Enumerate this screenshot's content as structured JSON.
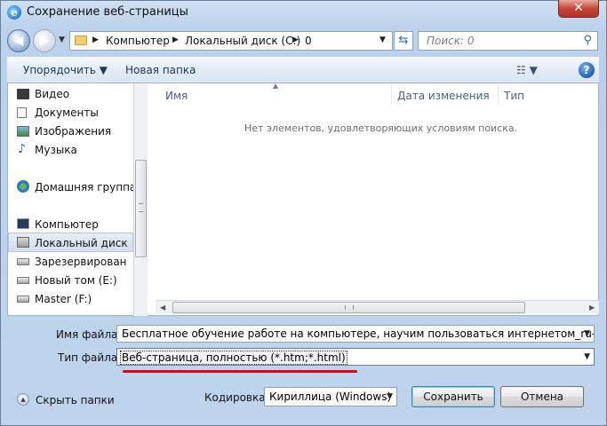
{
  "window": {
    "title": "Сохранение веб-страницы",
    "close_glyph": "✕"
  },
  "nav": {
    "back_glyph": "◀",
    "forward_glyph": "▶",
    "breadcrumb": [
      "Компьютер",
      "Локальный диск (C:)",
      "0"
    ],
    "search_placeholder": "Поиск: 0"
  },
  "toolbar": {
    "organize_label": "Упорядочить ▼",
    "new_folder_label": "Новая папка",
    "view_glyph": "☷ ▼",
    "help_glyph": "?"
  },
  "sidebar": {
    "items": [
      {
        "label": "Видео",
        "icon": "video-icon"
      },
      {
        "label": "Документы",
        "icon": "documents-icon"
      },
      {
        "label": "Изображения",
        "icon": "pictures-icon"
      },
      {
        "label": "Музыка",
        "icon": "music-icon"
      },
      {
        "label": "Домашняя группа",
        "icon": "homegroup-icon"
      },
      {
        "label": "Компьютер",
        "icon": "computer-icon"
      },
      {
        "label": "Локальный диск",
        "icon": "drive-icon",
        "selected": true
      },
      {
        "label": "Зарезервирован",
        "icon": "drive-icon"
      },
      {
        "label": "Новый том (E:)",
        "icon": "drive-icon"
      },
      {
        "label": "Master (F:)",
        "icon": "drive-icon"
      }
    ]
  },
  "file_list": {
    "columns": [
      "Имя",
      "Дата изменения",
      "Тип"
    ],
    "empty_message": "Нет элементов, удовлетворяющих условиям поиска."
  },
  "form": {
    "filename_label": "Имя файла:",
    "filename_value": "Бесплатное обучение работе на компьютере, научим пользоваться интернетом_ru-",
    "filetype_label": "Тип файла:",
    "filetype_value": "Веб-страница, полностью (*.htm;*.html)",
    "encoding_label": "Кодировка:",
    "encoding_value": "Кириллица (Windows)",
    "hide_folders_label": "Скрыть папки",
    "save_label": "Сохранить",
    "cancel_label": "Отмена"
  },
  "colors": {
    "accent_red": "#e2000f",
    "toolbar_text": "#1e395b"
  }
}
